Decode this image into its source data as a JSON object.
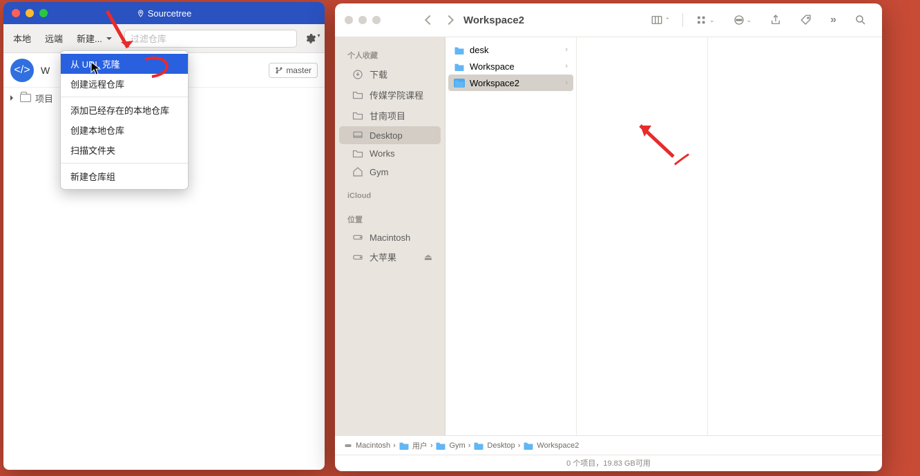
{
  "sourcetree": {
    "title": "Sourcetree",
    "tabs": {
      "local": "本地",
      "remote": "远端",
      "new": "新建..."
    },
    "filter_placeholder": "过滤仓库",
    "repo": "W",
    "master_btn": "master",
    "project_row": "项目",
    "dropdown": {
      "clone_url": "从 URL 克隆",
      "create_remote": "创建远程仓库",
      "add_existing": "添加已经存在的本地仓库",
      "create_local": "创建本地仓库",
      "scan_folder": "扫描文件夹",
      "new_group": "新建仓库组"
    }
  },
  "finder": {
    "title": "Workspace2",
    "sidebar": {
      "heads": {
        "fav": "个人收藏",
        "icloud": "iCloud",
        "loc": "位置"
      },
      "downloads": "下载",
      "media_course": "传媒学院课程",
      "gannan": "甘南项目",
      "desktop": "Desktop",
      "works": "Works",
      "gym": "Gym",
      "macintosh": "Macintosh",
      "bigapple": "大苹果"
    },
    "col_items": {
      "desk": "desk",
      "workspace": "Workspace",
      "workspace2": "Workspace2"
    },
    "path": {
      "disk": "Macintosh",
      "users": "用户",
      "gym": "Gym",
      "desktop": "Desktop",
      "workspace2": "Workspace2"
    },
    "status": "0 个项目，19.83 GB可用"
  }
}
